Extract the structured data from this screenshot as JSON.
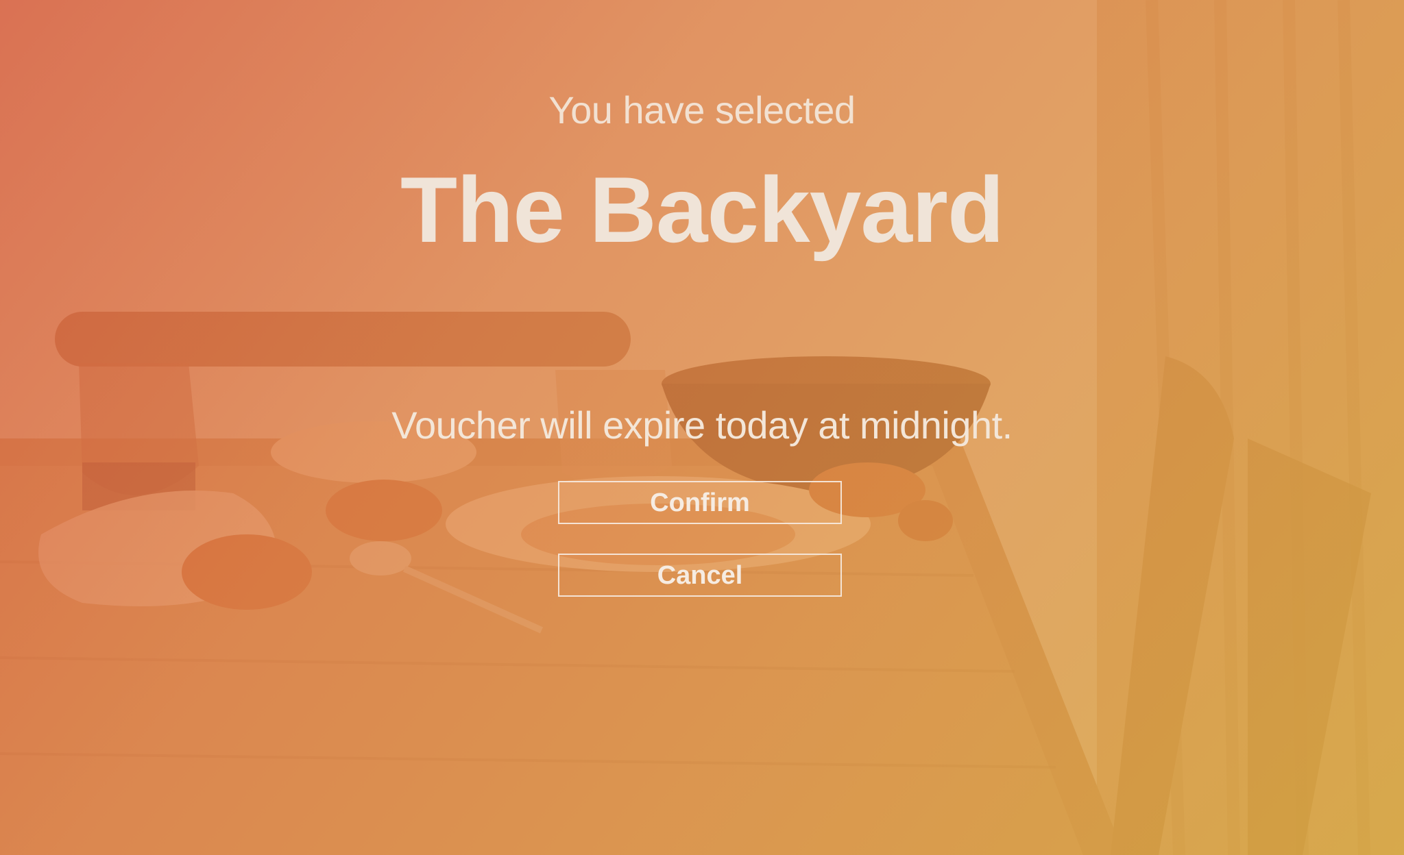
{
  "dialog": {
    "subtitle": "You have selected",
    "venue_name": "The Backyard",
    "notice": "Voucher will expire today at midnight.",
    "confirm_label": "Confirm",
    "cancel_label": "Cancel"
  },
  "colors": {
    "gradient_start": "#d65c3e",
    "gradient_mid": "#de8a48",
    "gradient_end": "#d6aa40",
    "text": "#f3e6d8",
    "button_border": "#f5e8dc"
  },
  "background_image": "dining-table-photo"
}
